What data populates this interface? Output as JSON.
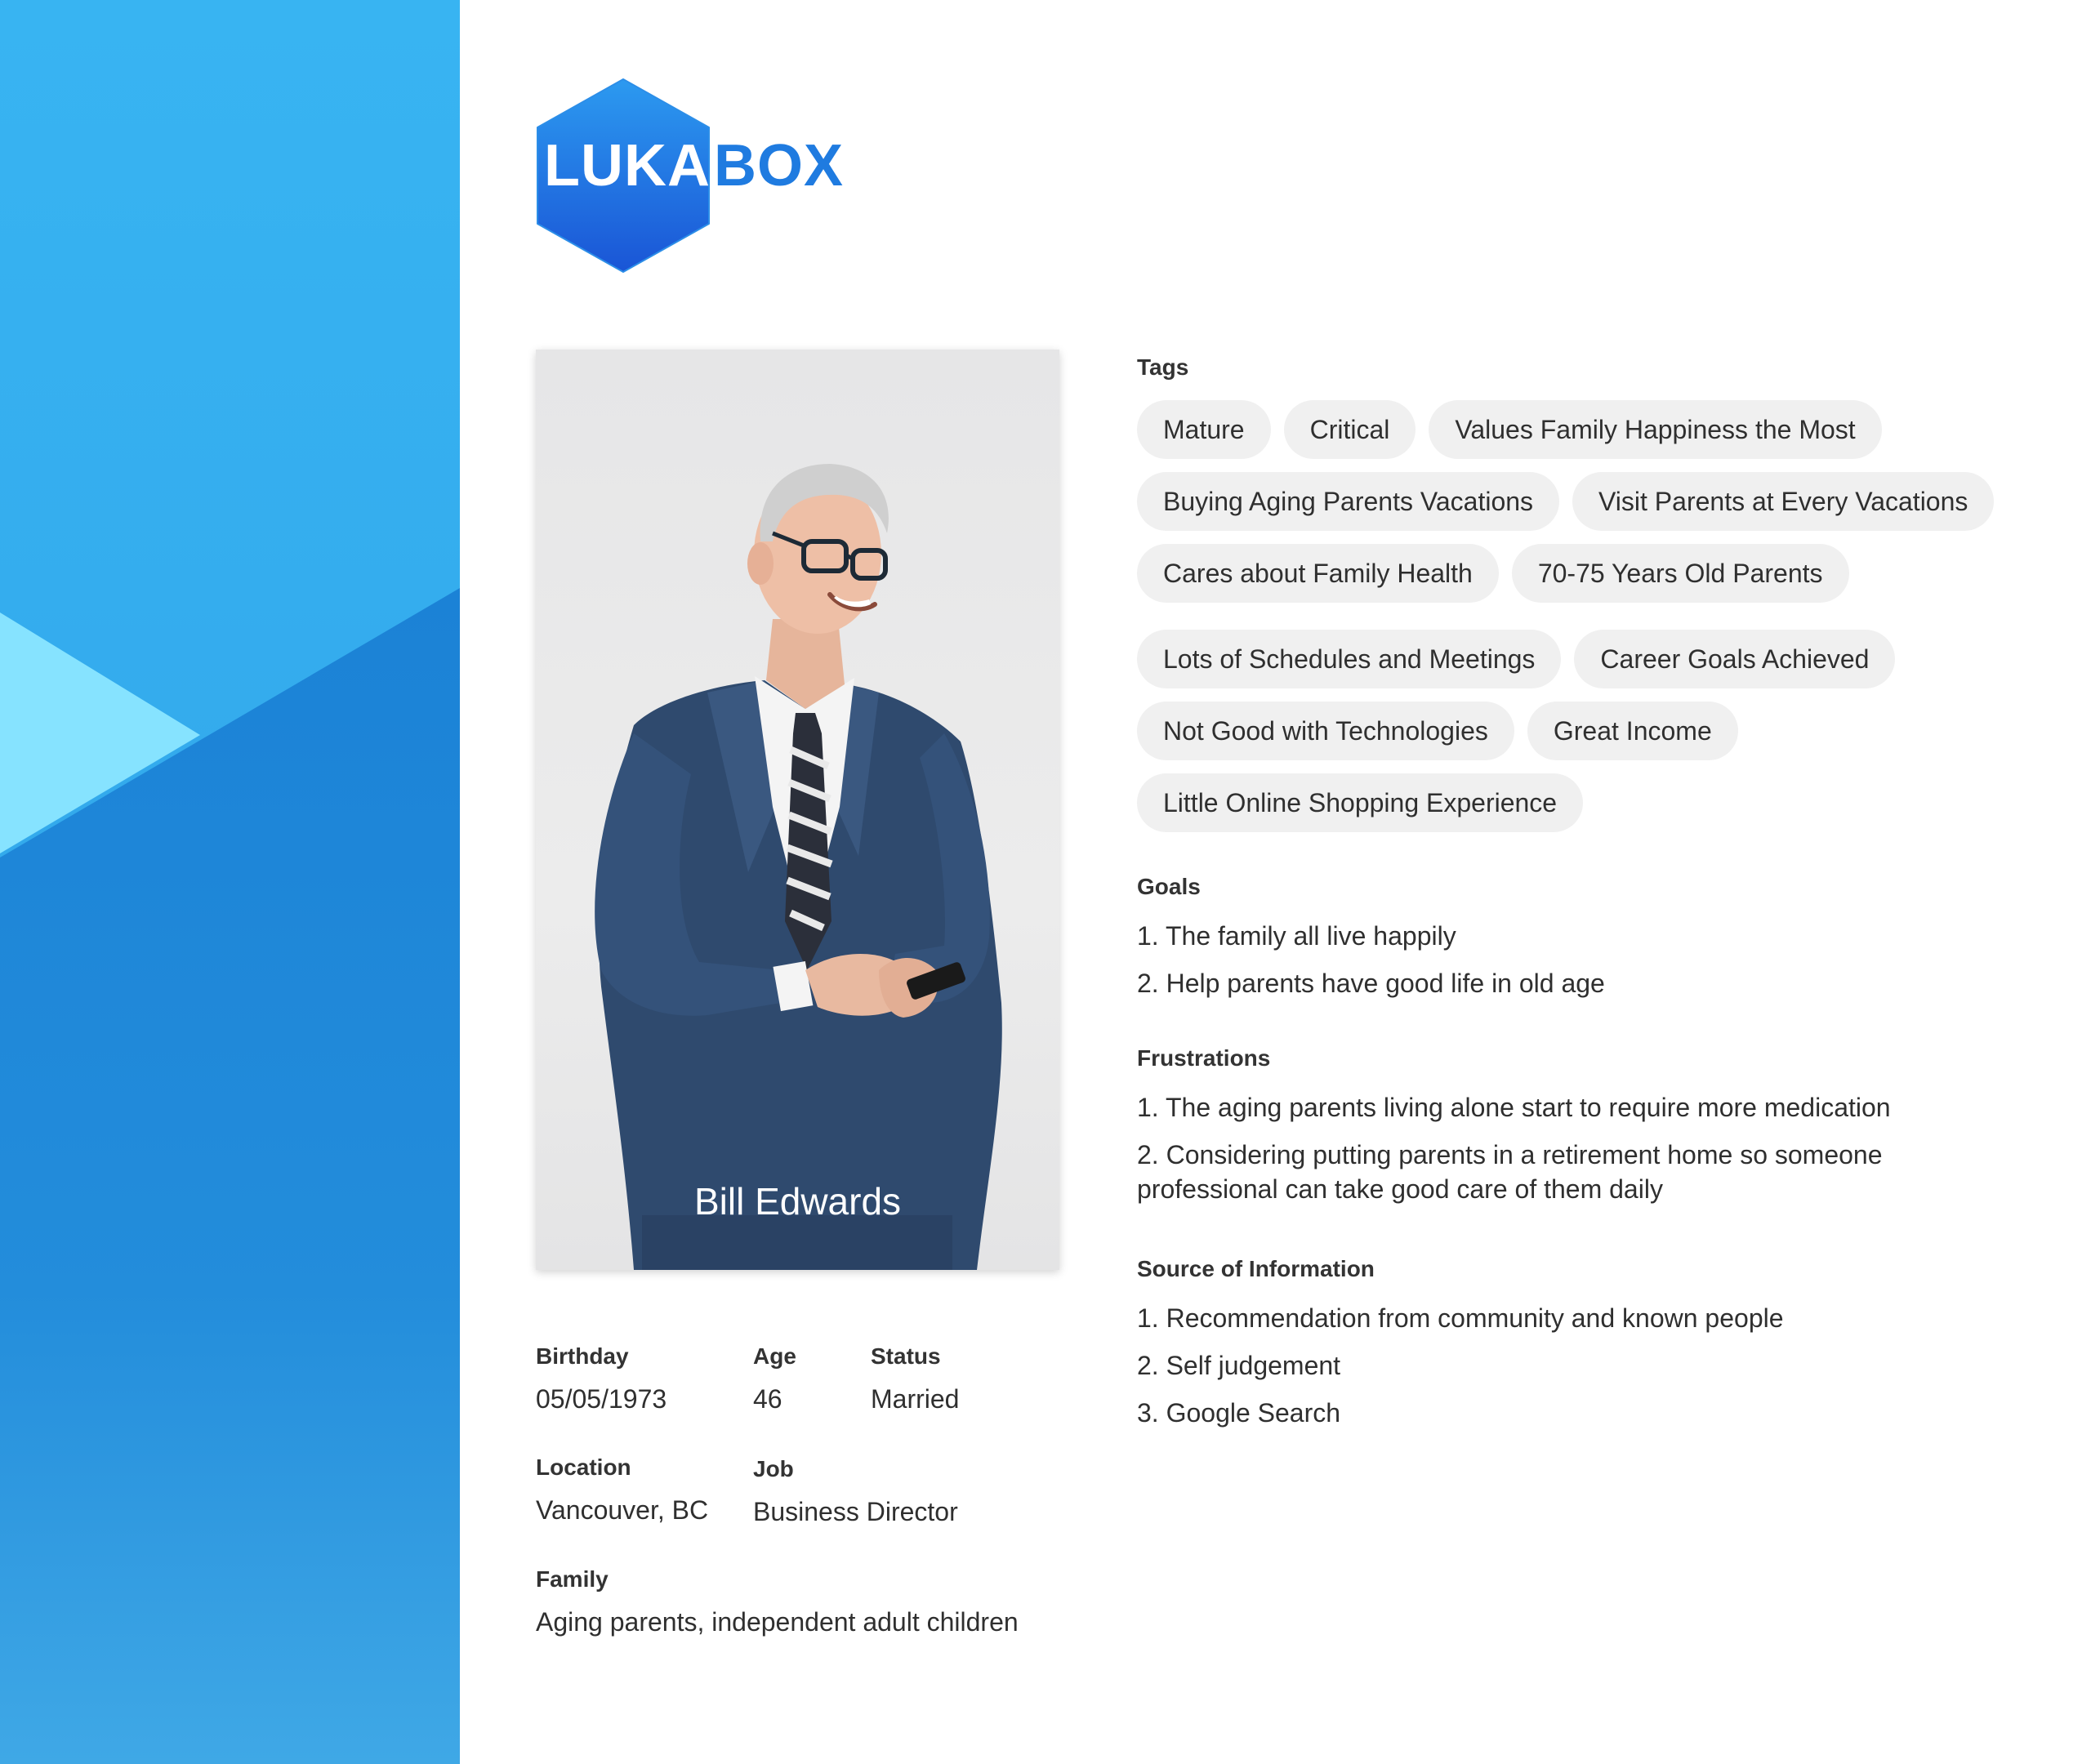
{
  "logo": {
    "text_left": "LUKA",
    "text_right": "BOX"
  },
  "profile": {
    "name": "Bill Edwards",
    "fields": {
      "birthday": {
        "label": "Birthday",
        "value": "05/05/1973"
      },
      "age": {
        "label": "Age",
        "value": "46"
      },
      "status": {
        "label": "Status",
        "value": "Married"
      },
      "location": {
        "label": "Location",
        "value": "Vancouver, BC"
      },
      "job": {
        "label": "Job",
        "value": "Business Director"
      },
      "family": {
        "label": "Family",
        "value": "Aging parents, independent adult children"
      }
    }
  },
  "tags": {
    "label": "Tags",
    "items": [
      "Mature",
      "Critical",
      "Values Family Happiness the Most",
      "Buying Aging Parents Vacations",
      "Visit Parents at Every Vacations",
      "Cares about Family Health",
      "70-75 Years Old Parents",
      "Lots of Schedules and Meetings",
      "Career Goals Achieved",
      "Not Good with Technologies",
      "Great Income",
      "Little Online Shopping Experience"
    ]
  },
  "goals": {
    "label": "Goals",
    "items": [
      "1. The family all live happily",
      "2. Help parents have good life in old age"
    ]
  },
  "frustrations": {
    "label": "Frustrations",
    "items": [
      "1. The aging parents living alone start to require more medication",
      "2. Considering putting parents in a retirement home so someone professional can take good care of them daily"
    ]
  },
  "sources": {
    "label": "Source of Information",
    "items": [
      "1. Recommendation from community and known people",
      "2. Self judgement",
      "3. Google Search"
    ]
  },
  "colors": {
    "panel_top": "#33b0f0",
    "panel_bottom": "#2a8fd8",
    "panel_light_triangle": "#86e3ff",
    "accent_blue": "#1f7be0",
    "tag_background": "#f0f0f0"
  }
}
